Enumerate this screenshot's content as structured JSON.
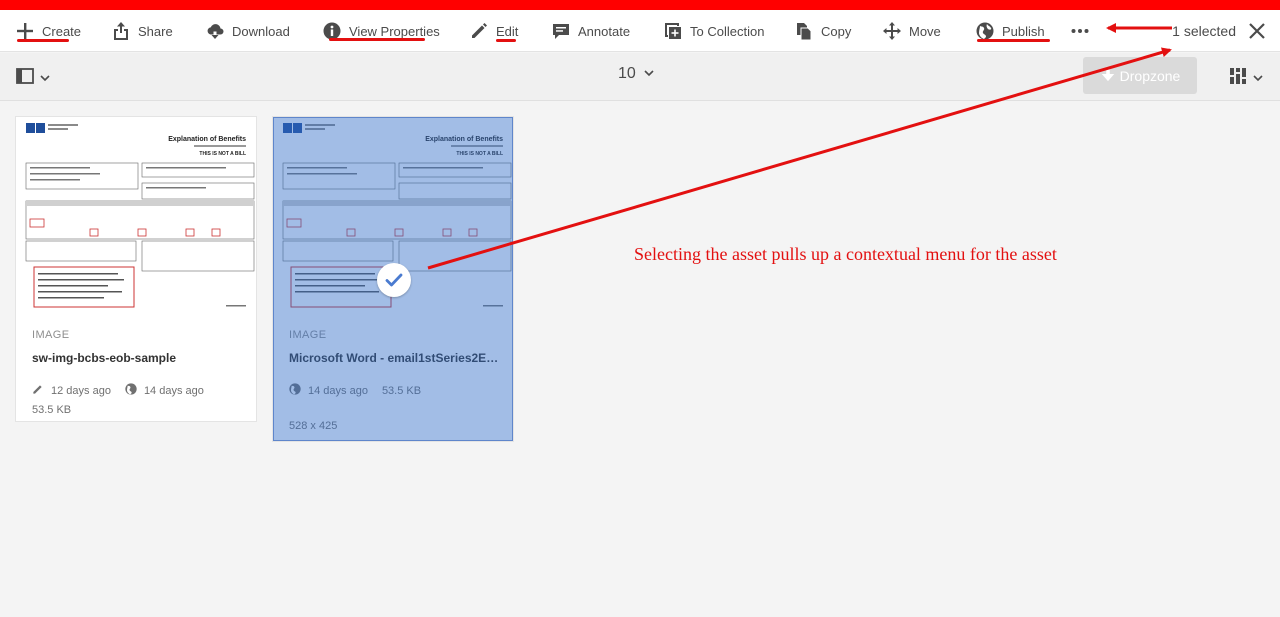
{
  "toolbar": {
    "actions": [
      {
        "label": "Create",
        "icon": "plus-icon"
      },
      {
        "label": "Share",
        "icon": "share-icon"
      },
      {
        "label": "Download",
        "icon": "download-icon"
      },
      {
        "label": "View Properties",
        "icon": "info-icon"
      },
      {
        "label": "Edit",
        "icon": "pencil-icon"
      },
      {
        "label": "Annotate",
        "icon": "comment-icon"
      },
      {
        "label": "To Collection",
        "icon": "collection-icon"
      },
      {
        "label": "Copy",
        "icon": "copy-icon"
      },
      {
        "label": "Move",
        "icon": "move-icon"
      },
      {
        "label": "Publish",
        "icon": "globe-icon"
      }
    ],
    "more_icon": "more-icon",
    "selection_text": "1 selected",
    "close_icon": "close-icon"
  },
  "secondary_bar": {
    "rail_icon": "rail-toggle-icon",
    "page_size": "10",
    "dropzone_label": "Dropzone",
    "view_icon": "card-view-icon"
  },
  "assets": [
    {
      "type": "IMAGE",
      "title": "sw-img-bcbs-eob-sample",
      "modified": "12 days ago",
      "published": "14 days ago",
      "size": "53.5 KB",
      "selected": false
    },
    {
      "type": "IMAGE",
      "title": "Microsoft Word - email1stSeries2EO...",
      "published": "14 days ago",
      "size": "53.5 KB",
      "dimensions": "528 x 425",
      "selected": true
    }
  ],
  "document_thumb": {
    "heading": "Explanation of Benefits",
    "notice": "THIS IS NOT A BILL"
  },
  "annotation": {
    "text": "Selecting the asset pulls up a contextual menu for the asset"
  },
  "colors": {
    "annotation_red": "#e31010",
    "top_bar_red": "#ff0000",
    "selection_blue": "#316dc8"
  }
}
